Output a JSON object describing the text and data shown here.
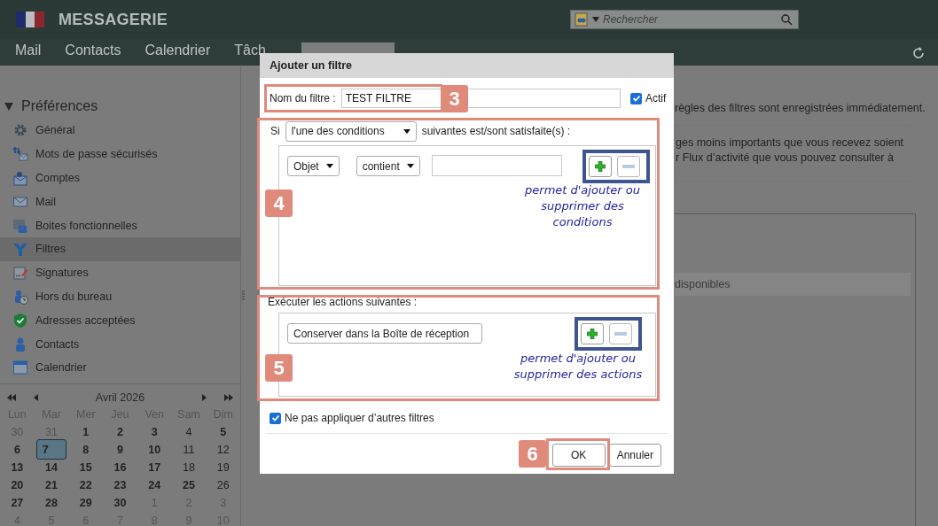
{
  "header": {
    "title": "MESSAGERIE",
    "search": {
      "placeholder": "Rechercher"
    }
  },
  "tabs": [
    {
      "label": "Mail",
      "selected": false
    },
    {
      "label": "Contacts",
      "selected": false
    },
    {
      "label": "Calendrier",
      "selected": false
    },
    {
      "label": "Tâch",
      "selected": false
    },
    {
      "selected": true
    }
  ],
  "sidebar": {
    "title": "Préférences",
    "expanded": true,
    "items": [
      {
        "label": "Général",
        "selected": false
      },
      {
        "label": "Mots de passe sécurisés",
        "selected": false
      },
      {
        "label": "Comptes",
        "selected": false
      },
      {
        "label": "Mail",
        "selected": false
      },
      {
        "label": "Boites fonctionnelles",
        "selected": false
      },
      {
        "label": "Filtres",
        "selected": true
      },
      {
        "label": "Signatures",
        "selected": false
      },
      {
        "label": "Hors du bureau",
        "selected": false
      },
      {
        "label": "Adresses acceptées",
        "selected": false
      },
      {
        "label": "Contacts",
        "selected": false
      },
      {
        "label": "Calendrier",
        "selected": false
      }
    ]
  },
  "calendar": {
    "month": "Avril 2026",
    "weekdays": [
      "Lun",
      "Mar",
      "Mer",
      "Jeu",
      "Ven",
      "Sam",
      "Dim"
    ],
    "days": [
      {
        "day": "30",
        "outside": true,
        "bold": false,
        "selected": false
      },
      {
        "day": "31",
        "outside": true,
        "bold": false,
        "selected": false
      },
      {
        "day": "1",
        "outside": false,
        "bold": true,
        "selected": false
      },
      {
        "day": "2",
        "outside": false,
        "bold": true,
        "selected": false
      },
      {
        "day": "3",
        "outside": false,
        "bold": true,
        "selected": false
      },
      {
        "day": "4",
        "outside": false,
        "bold": false,
        "selected": false
      },
      {
        "day": "5",
        "outside": false,
        "bold": true,
        "selected": false
      },
      {
        "day": "6",
        "outside": false,
        "bold": true,
        "selected": false
      },
      {
        "day": "7",
        "outside": false,
        "bold": true,
        "selected": true
      },
      {
        "day": "8",
        "outside": false,
        "bold": true,
        "selected": false
      },
      {
        "day": "9",
        "outside": false,
        "bold": true,
        "selected": false
      },
      {
        "day": "10",
        "outside": false,
        "bold": true,
        "selected": false
      },
      {
        "day": "11",
        "outside": false,
        "bold": false,
        "selected": false
      },
      {
        "day": "12",
        "outside": false,
        "bold": false,
        "selected": false
      },
      {
        "day": "13",
        "outside": false,
        "bold": true,
        "selected": false
      },
      {
        "day": "14",
        "outside": false,
        "bold": true,
        "selected": false
      },
      {
        "day": "15",
        "outside": false,
        "bold": true,
        "selected": false
      },
      {
        "day": "16",
        "outside": false,
        "bold": true,
        "selected": false
      },
      {
        "day": "17",
        "outside": false,
        "bold": true,
        "selected": false
      },
      {
        "day": "18",
        "outside": false,
        "bold": false,
        "selected": false
      },
      {
        "day": "19",
        "outside": false,
        "bold": false,
        "selected": false
      },
      {
        "day": "20",
        "outside": false,
        "bold": true,
        "selected": false
      },
      {
        "day": "21",
        "outside": false,
        "bold": true,
        "selected": false
      },
      {
        "day": "22",
        "outside": false,
        "bold": true,
        "selected": false
      },
      {
        "day": "23",
        "outside": false,
        "bold": true,
        "selected": false
      },
      {
        "day": "24",
        "outside": false,
        "bold": true,
        "selected": false
      },
      {
        "day": "25",
        "outside": false,
        "bold": true,
        "selected": false
      },
      {
        "day": "26",
        "outside": false,
        "bold": false,
        "selected": false
      },
      {
        "day": "27",
        "outside": false,
        "bold": true,
        "selected": false
      },
      {
        "day": "28",
        "outside": false,
        "bold": true,
        "selected": false
      },
      {
        "day": "29",
        "outside": false,
        "bold": true,
        "selected": false
      },
      {
        "day": "30",
        "outside": false,
        "bold": true,
        "selected": false
      },
      {
        "day": "1",
        "outside": true,
        "bold": false,
        "selected": false
      },
      {
        "day": "2",
        "outside": true,
        "bold": false,
        "selected": false
      },
      {
        "day": "3",
        "outside": true,
        "bold": false,
        "selected": false
      },
      {
        "day": "4",
        "outside": true,
        "bold": false,
        "selected": false
      },
      {
        "day": "5",
        "outside": true,
        "bold": false,
        "selected": false
      },
      {
        "day": "6",
        "outside": true,
        "bold": false,
        "selected": false
      },
      {
        "day": "7",
        "outside": true,
        "bold": false,
        "selected": false
      },
      {
        "day": "8",
        "outside": true,
        "bold": false,
        "selected": false
      },
      {
        "day": "9",
        "outside": true,
        "bold": false,
        "selected": false
      },
      {
        "day": "10",
        "outside": true,
        "bold": false,
        "selected": false
      }
    ]
  },
  "content": {
    "notice": "règles des filtres sont enregistrées immédiatement.",
    "info_lines": [
      "ges moins importants que vous recevez soient",
      "r Flux d’activité que vous pouvez consulter à"
    ],
    "list_header": "disponibles"
  },
  "dialog": {
    "title": "Ajouter un filtre",
    "name_label": "Nom du filtre :",
    "name_value": "TEST FILTRE",
    "active": {
      "label": "Actif",
      "checked": true
    },
    "conditions": {
      "prefix": "Si",
      "match": "l'une des conditions",
      "suffix": "suivantes est/sont satisfaite(s) :",
      "rows": [
        {
          "field": "Objet",
          "operator": "contient",
          "buttons": [
            {
              "kind": "add",
              "disabled": false
            },
            {
              "kind": "remove",
              "disabled": true
            }
          ]
        }
      ]
    },
    "actions": {
      "title": "Exécuter les actions suivantes :",
      "rows": [
        {
          "action": "Conserver dans la Boîte de réception",
          "buttons": [
            {
              "kind": "add",
              "disabled": false
            },
            {
              "kind": "remove",
              "disabled": true
            }
          ]
        }
      ]
    },
    "stop": {
      "label": "Ne pas appliquer d’autres filtres",
      "checked": true
    },
    "buttons": [
      "OK",
      "Annuler"
    ]
  },
  "callouts": {
    "badges": [
      "3",
      "4",
      "5",
      "6"
    ],
    "notes": [
      "permet d'ajouter ou supprimer des conditions",
      "permet d'ajouter ou supprimer des actions"
    ]
  }
}
